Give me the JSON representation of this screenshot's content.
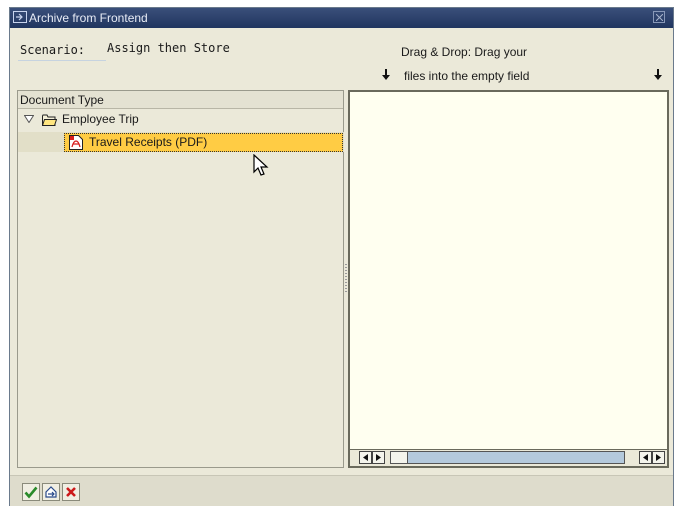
{
  "window": {
    "title": "Archive from Frontend",
    "title_icon": "archive-window-icon",
    "close_icon": "close-icon"
  },
  "scenario": {
    "label": "Scenario:",
    "value": "Assign then Store"
  },
  "drop_instructions": {
    "line1": "Drag & Drop: Drag your",
    "line2": "files into the empty field",
    "arrow_icon": "arrow-down-icon"
  },
  "tree": {
    "header": "Document Type",
    "nodes": [
      {
        "label": "Employee Trip",
        "icon": "folder-open-icon",
        "expanded": true
      },
      {
        "label": "Travel Receipts (PDF)",
        "icon": "pdf-icon",
        "selected": true
      }
    ]
  },
  "drop_area": {
    "scrollbar_left_icons": [
      "scroll-left-icon",
      "scroll-right-icon"
    ],
    "scrollbar_right_icons": [
      "scroll-left-icon",
      "scroll-right-icon"
    ]
  },
  "footer": {
    "buttons": [
      "checkmark-icon",
      "transfer-icon",
      "cancel-icon"
    ]
  },
  "colors": {
    "title_bar": "#20355f",
    "background": "#ebe9d9",
    "selection": "#ffcc44",
    "drop_area": "#fffff0",
    "scroll_track": "#b4c9dc",
    "confirm": "#2a8a2a",
    "cancel": "#cc1a1a"
  }
}
